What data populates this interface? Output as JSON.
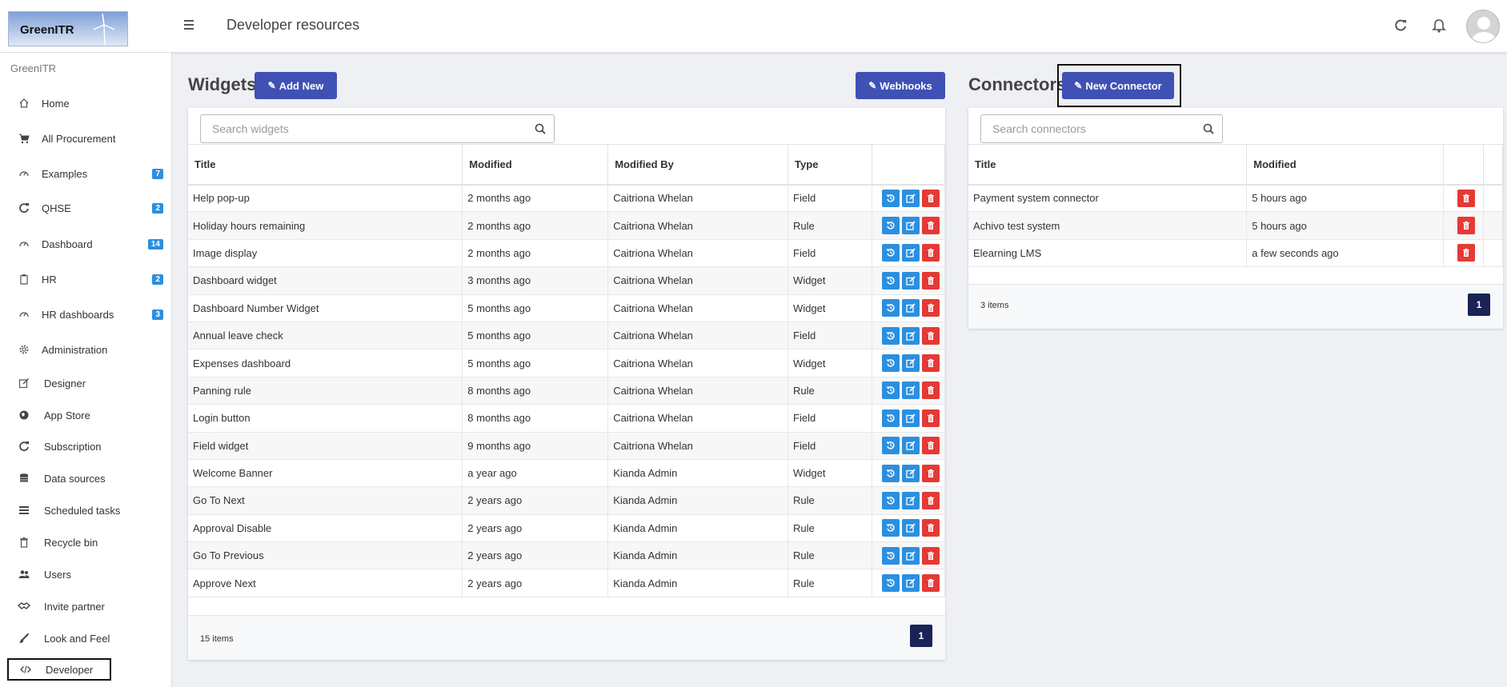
{
  "header": {
    "logo_text": "GreenITR",
    "page_title": "Developer resources"
  },
  "sidebar": {
    "org_name": "GreenITR",
    "items": [
      {
        "label": "Home",
        "icon": "home-icon"
      },
      {
        "label": "All Procurement",
        "icon": "cart-icon"
      },
      {
        "label": "Examples",
        "icon": "gauge-icon",
        "badge": "7"
      },
      {
        "label": "QHSE",
        "icon": "refresh-icon",
        "badge": "2"
      },
      {
        "label": "Dashboard",
        "icon": "gauge-icon",
        "badge": "14"
      },
      {
        "label": "HR",
        "icon": "clipboard-icon",
        "badge": "2"
      },
      {
        "label": "HR dashboards",
        "icon": "gauge-icon",
        "badge": "3"
      },
      {
        "label": "Administration",
        "icon": "gear-icon"
      },
      {
        "label": "Designer",
        "icon": "edit-icon"
      },
      {
        "label": "App Store",
        "icon": "globe-icon"
      },
      {
        "label": "Subscription",
        "icon": "refresh-icon"
      },
      {
        "label": "Data sources",
        "icon": "database-icon"
      },
      {
        "label": "Scheduled tasks",
        "icon": "tasks-icon"
      },
      {
        "label": "Recycle bin",
        "icon": "trash-icon"
      },
      {
        "label": "Users",
        "icon": "users-icon"
      },
      {
        "label": "Invite partner",
        "icon": "handshake-icon"
      },
      {
        "label": "Look and Feel",
        "icon": "brush-icon"
      },
      {
        "label": "Developer",
        "icon": "code-icon"
      }
    ]
  },
  "widgets": {
    "title": "Widgets",
    "add_label": "Add New",
    "webhooks_label": "Webhooks",
    "search_placeholder": "Search widgets",
    "columns": [
      "Title",
      "Modified",
      "Modified By",
      "Type"
    ],
    "rows": [
      [
        "Help pop-up",
        "2 months ago",
        "Caitriona Whelan",
        "Field"
      ],
      [
        "Holiday hours remaining",
        "2 months ago",
        "Caitriona Whelan",
        "Rule"
      ],
      [
        "Image display",
        "2 months ago",
        "Caitriona Whelan",
        "Field"
      ],
      [
        "Dashboard widget",
        "3 months ago",
        "Caitriona Whelan",
        "Widget"
      ],
      [
        "Dashboard Number Widget",
        "5 months ago",
        "Caitriona Whelan",
        "Widget"
      ],
      [
        "Annual leave check",
        "5 months ago",
        "Caitriona Whelan",
        "Field"
      ],
      [
        "Expenses dashboard",
        "5 months ago",
        "Caitriona Whelan",
        "Widget"
      ],
      [
        "Panning rule",
        "8 months ago",
        "Caitriona Whelan",
        "Rule"
      ],
      [
        "Login button",
        "8 months ago",
        "Caitriona Whelan",
        "Field"
      ],
      [
        "Field widget",
        "9 months ago",
        "Caitriona Whelan",
        "Field"
      ],
      [
        "Welcome Banner",
        "a year ago",
        "Kianda Admin",
        "Widget"
      ],
      [
        "Go To Next",
        "2 years ago",
        "Kianda Admin",
        "Rule"
      ],
      [
        "Approval Disable",
        "2 years ago",
        "Kianda Admin",
        "Rule"
      ],
      [
        "Go To Previous",
        "2 years ago",
        "Kianda Admin",
        "Rule"
      ],
      [
        "Approve Next",
        "2 years ago",
        "Kianda Admin",
        "Rule"
      ]
    ],
    "items_count": "15 items",
    "page": "1"
  },
  "connectors": {
    "title": "Connectors",
    "new_label": "New Connector",
    "search_placeholder": "Search connectors",
    "columns": [
      "Title",
      "Modified"
    ],
    "rows": [
      [
        "Payment system connector",
        "5 hours ago"
      ],
      [
        "Achivo test system",
        "5 hours ago"
      ],
      [
        "Elearning LMS",
        "a few seconds ago"
      ]
    ],
    "items_count": "3 items",
    "page": "1"
  },
  "colors": {
    "primary": "#3f51b5",
    "action_blue": "#2b8fe0",
    "action_red": "#e53935",
    "pager": "#1a2355"
  }
}
